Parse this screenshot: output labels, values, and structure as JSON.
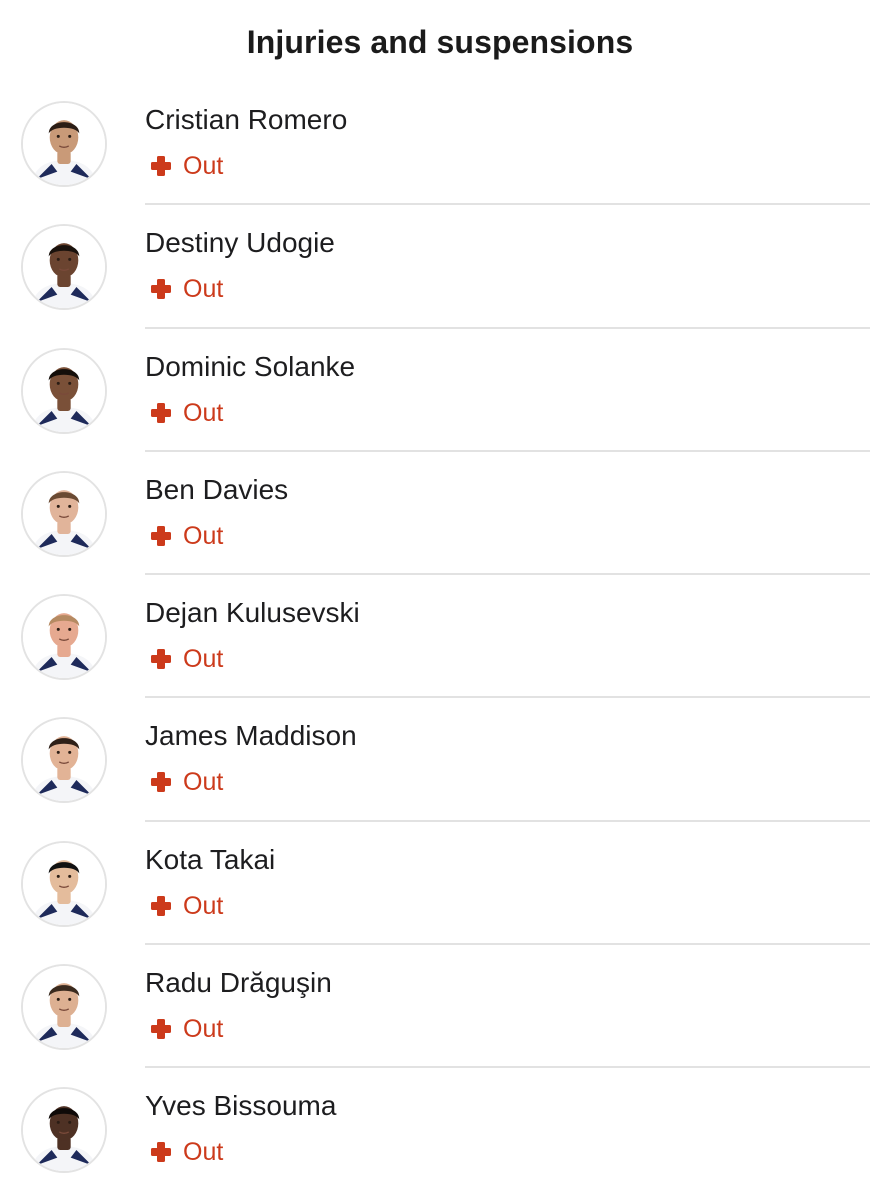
{
  "header": {
    "title": "Injuries and suspensions"
  },
  "colors": {
    "status_red": "#cc3a1b",
    "divider": "#e2e2e2",
    "kit_navy": "#1e2a5a"
  },
  "players": [
    {
      "name": "Cristian Romero",
      "status": "Out",
      "status_icon": "medical-cross-icon",
      "skin": "#c99a78",
      "hair": "#2b1d15"
    },
    {
      "name": "Destiny Udogie",
      "status": "Out",
      "status_icon": "medical-cross-icon",
      "skin": "#6b4430",
      "hair": "#1a120d"
    },
    {
      "name": "Dominic Solanke",
      "status": "Out",
      "status_icon": "medical-cross-icon",
      "skin": "#7a5038",
      "hair": "#140e0a"
    },
    {
      "name": "Ben Davies",
      "status": "Out",
      "status_icon": "medical-cross-icon",
      "skin": "#e1b49a",
      "hair": "#6a4a33"
    },
    {
      "name": "Dejan Kulusevski",
      "status": "Out",
      "status_icon": "medical-cross-icon",
      "skin": "#e6a990",
      "hair": "#b58a62"
    },
    {
      "name": "James Maddison",
      "status": "Out",
      "status_icon": "medical-cross-icon",
      "skin": "#e2b396",
      "hair": "#2e2018"
    },
    {
      "name": "Kota Takai",
      "status": "Out",
      "status_icon": "medical-cross-icon",
      "skin": "#e4bc9c",
      "hair": "#111111"
    },
    {
      "name": "Radu Drăguşin",
      "status": "Out",
      "status_icon": "medical-cross-icon",
      "skin": "#ddb092",
      "hair": "#3a2a1e"
    },
    {
      "name": "Yves Bissouma",
      "status": "Out",
      "status_icon": "medical-cross-icon",
      "skin": "#4e3124",
      "hair": "#0f0a08"
    }
  ]
}
